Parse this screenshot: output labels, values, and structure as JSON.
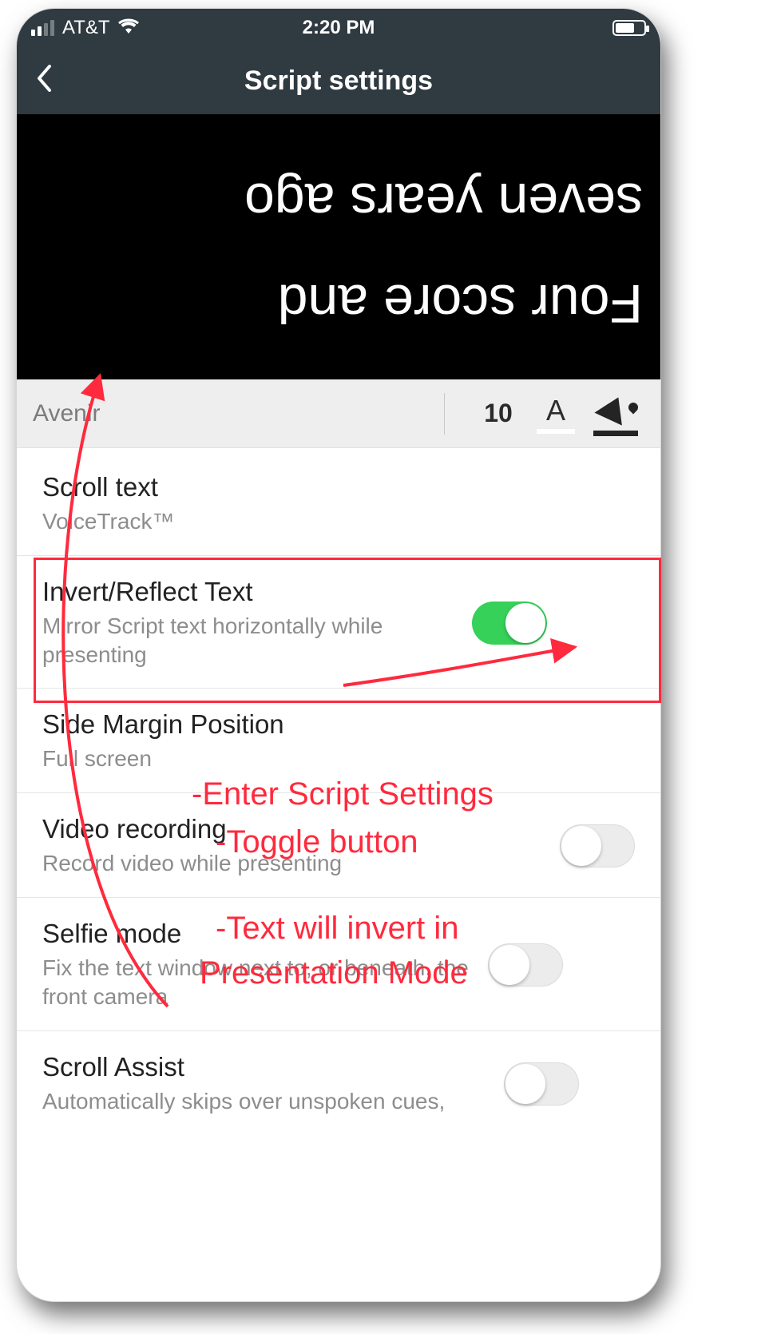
{
  "status": {
    "carrier": "AT&T",
    "time": "2:20 PM"
  },
  "nav": {
    "title": "Script settings"
  },
  "preview": {
    "line1": "seven years ago",
    "line2": "Four score and"
  },
  "fontrow": {
    "font_name": "Avenir",
    "font_size": "10"
  },
  "rows": {
    "scroll": {
      "title": "Scroll text",
      "sub": "VoiceTrack™"
    },
    "invert": {
      "title": "Invert/Reflect Text",
      "sub": "Mirror Script text horizontally while presenting"
    },
    "margin": {
      "title": "Side Margin Position",
      "sub": "Full screen"
    },
    "video": {
      "title": "Video recording",
      "sub": "Record video while presenting"
    },
    "selfie": {
      "title": "Selfie mode",
      "sub": "Fix the text window next to, or beneath, the front camera"
    },
    "assist": {
      "title": "Scroll Assist",
      "sub": "Automatically skips over unspoken cues,"
    }
  },
  "annotations": {
    "a1": "-Enter Script Settings",
    "a2": "-Toggle button",
    "a3": "-Text will invert in",
    "a4": "Presentation Mode"
  }
}
